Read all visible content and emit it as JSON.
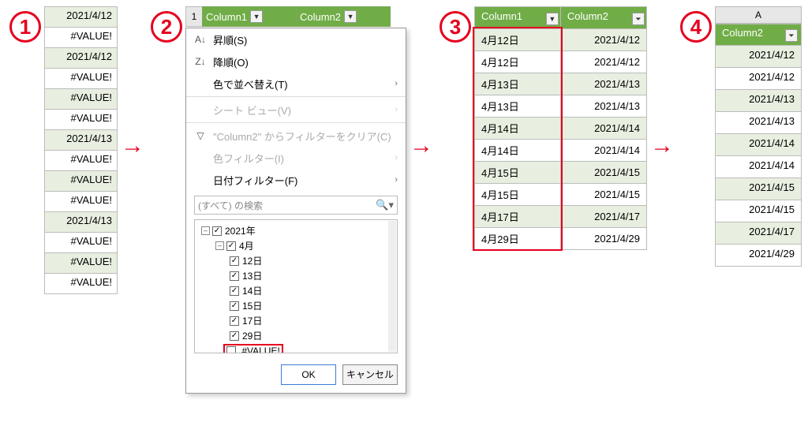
{
  "steps": {
    "s1": "1",
    "s2": "2",
    "s3": "3",
    "s4": "4"
  },
  "panel1": {
    "rows": [
      "2021/4/12",
      "#VALUE!",
      "2021/4/12",
      "#VALUE!",
      "#VALUE!",
      "#VALUE!",
      "2021/4/13",
      "#VALUE!",
      "#VALUE!",
      "#VALUE!",
      "2021/4/13",
      "#VALUE!",
      "#VALUE!",
      "#VALUE!"
    ]
  },
  "panel2": {
    "row_index": "1",
    "headers": {
      "c1": "Column1",
      "c2": "Column2"
    },
    "menu": {
      "sort_asc": "昇順(S)",
      "sort_desc": "降順(O)",
      "sort_color": "色で並べ替え(T)",
      "sheet_view": "シート ビュー(V)",
      "clear_filter": "\"Column2\" からフィルターをクリア(C)",
      "color_filter": "色フィルター(I)",
      "date_filter": "日付フィルター(F)",
      "search_placeholder": "(すべて) の検索",
      "tree": {
        "year": "2021年",
        "month": "4月",
        "days": [
          "12日",
          "13日",
          "14日",
          "15日",
          "17日",
          "29日"
        ],
        "error_item": "#VALUE!"
      },
      "ok": "OK",
      "cancel": "キャンセル"
    }
  },
  "panel3": {
    "headers": {
      "c1": "Column1",
      "c2": "Column2"
    },
    "rows": [
      {
        "c1": "4月12日",
        "c2": "2021/4/12"
      },
      {
        "c1": "4月12日",
        "c2": "2021/4/12"
      },
      {
        "c1": "4月13日",
        "c2": "2021/4/13"
      },
      {
        "c1": "4月13日",
        "c2": "2021/4/13"
      },
      {
        "c1": "4月14日",
        "c2": "2021/4/14"
      },
      {
        "c1": "4月14日",
        "c2": "2021/4/14"
      },
      {
        "c1": "4月15日",
        "c2": "2021/4/15"
      },
      {
        "c1": "4月15日",
        "c2": "2021/4/15"
      },
      {
        "c1": "4月17日",
        "c2": "2021/4/17"
      },
      {
        "c1": "4月29日",
        "c2": "2021/4/29"
      }
    ]
  },
  "panel4": {
    "column_letter": "A",
    "header": "Column2",
    "rows": [
      "2021/4/12",
      "2021/4/12",
      "2021/4/13",
      "2021/4/13",
      "2021/4/14",
      "2021/4/14",
      "2021/4/15",
      "2021/4/15",
      "2021/4/17",
      "2021/4/29"
    ]
  }
}
